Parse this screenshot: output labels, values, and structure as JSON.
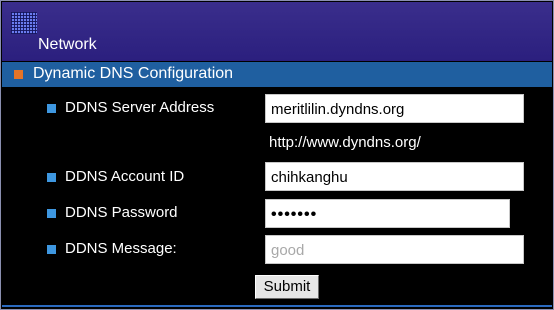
{
  "header": {
    "title": "Network"
  },
  "section": {
    "title": "Dynamic DNS Configuration"
  },
  "form": {
    "server_address": {
      "label": "DDNS Server Address",
      "value": "meritlilin.dyndns.org",
      "helper": "http://www.dyndns.org/"
    },
    "account_id": {
      "label": "DDNS Account ID",
      "value": "chihkanghu"
    },
    "password": {
      "label": "DDNS Password",
      "value": "•••••••"
    },
    "message": {
      "label": "DDNS Message:",
      "value": "good"
    },
    "submit_label": "Submit"
  },
  "colors": {
    "header_bg": "#2b1f7e",
    "section_bg": "#1f5fa0",
    "accent_orange": "#e57428",
    "accent_blue": "#3e97e0"
  }
}
